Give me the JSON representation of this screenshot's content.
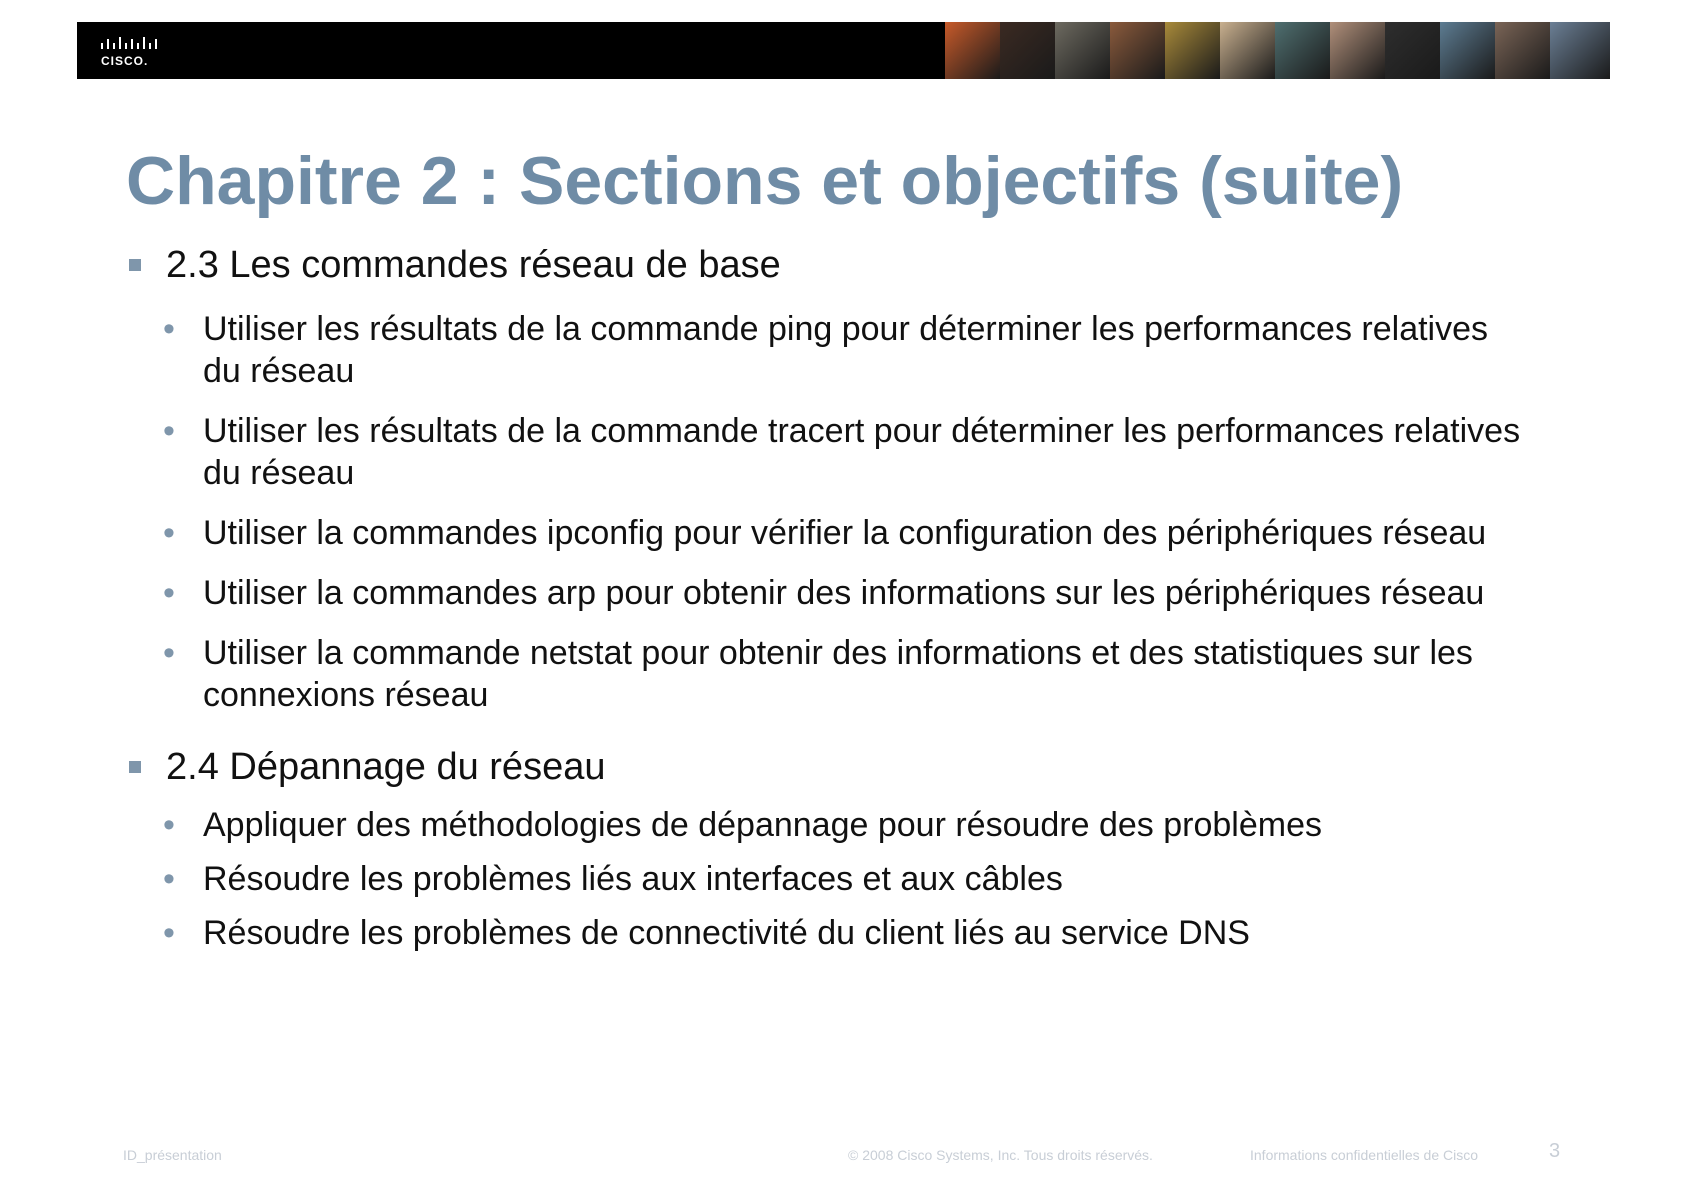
{
  "header": {
    "logo_text": "CISCO.",
    "photo_tiles": [
      {
        "color": "#c75a2a"
      },
      {
        "color": "#3b2a22"
      },
      {
        "color": "#6d6a60"
      },
      {
        "color": "#8a5a3c"
      },
      {
        "color": "#a88a3a"
      },
      {
        "color": "#c9b08f"
      },
      {
        "color": "#4f6f70"
      },
      {
        "color": "#b08f7a"
      },
      {
        "color": "#2e2e2e"
      },
      {
        "color": "#5d7c92"
      },
      {
        "color": "#7a6456"
      },
      {
        "color": "#6b7f95"
      }
    ]
  },
  "title": "Chapitre 2 : Sections et objectifs (suite)",
  "sections": [
    {
      "heading": "2.3 Les commandes réseau de base",
      "items": [
        "Utiliser les résultats de la commande ping pour déterminer les performances relatives du réseau",
        "Utiliser les résultats de la commande tracert pour déterminer les performances relatives du réseau",
        "Utiliser la commandes ipconfig pour vérifier la configuration des périphériques réseau",
        "Utiliser la commandes arp pour obtenir des informations sur les périphériques réseau",
        "Utiliser la commande netstat pour obtenir des informations et des statistiques sur les connexions réseau"
      ]
    },
    {
      "heading": "2.4 Dépannage du réseau",
      "items": [
        "Appliquer des méthodologies de dépannage pour résoudre des problèmes",
        "Résoudre les problèmes liés aux interfaces et aux câbles",
        "Résoudre les problèmes de connectivité du client liés au service DNS"
      ]
    }
  ],
  "footer": {
    "left": "ID_présentation",
    "copyright": "© 2008 Cisco Systems, Inc. Tous droits réservés.",
    "confidential": "Informations confidentielles de Cisco",
    "page_number": "3"
  },
  "colors": {
    "title": "#6f8ca6",
    "bullet": "#7f96ab",
    "footer_text": "#c8ced6"
  }
}
